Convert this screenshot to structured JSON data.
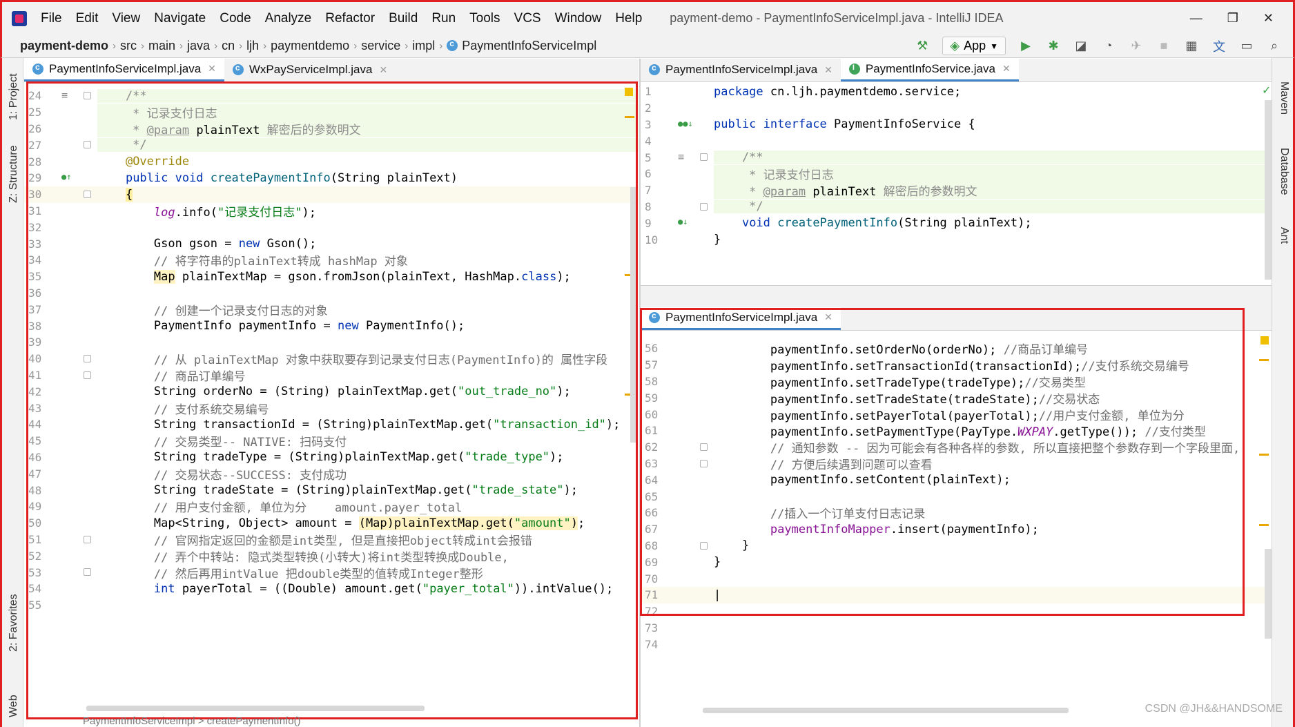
{
  "app": {
    "menu": [
      "File",
      "Edit",
      "View",
      "Navigate",
      "Code",
      "Analyze",
      "Refactor",
      "Build",
      "Run",
      "Tools",
      "VCS",
      "Window",
      "Help"
    ],
    "window_title": "payment-demo - PaymentInfoServiceImpl.java - IntelliJ IDEA",
    "controls": {
      "minimize": "—",
      "restore": "❐",
      "close": "✕"
    }
  },
  "breadcrumb": [
    "payment-demo",
    "src",
    "main",
    "java",
    "cn",
    "ljh",
    "paymentdemo",
    "service",
    "impl",
    "PaymentInfoServiceImpl"
  ],
  "toolbar": {
    "run_config": "App"
  },
  "left_strip": {
    "project": "1: Project",
    "structure": "Z: Structure",
    "favorites": "2: Favorites",
    "web": "Web"
  },
  "right_strip": {
    "maven": "Maven",
    "database": "Database",
    "ant": "Ant"
  },
  "left_pane": {
    "tabs": [
      {
        "label": "PaymentInfoServiceImpl.java",
        "active": true
      },
      {
        "label": "WxPayServiceImpl.java",
        "active": false
      }
    ],
    "lines": [
      {
        "n": "24",
        "c": [
          [
            "    /**",
            "doc"
          ]
        ],
        "doc": true
      },
      {
        "n": "25",
        "c": [
          [
            "     * 记录支付日志",
            "doc"
          ]
        ],
        "doc": true
      },
      {
        "n": "26",
        "c": [
          [
            "     * ",
            "doc"
          ],
          [
            "@param",
            "docu"
          ],
          [
            " plainText ",
            "doc-b"
          ],
          [
            "解密后的参数明文",
            "doc"
          ]
        ],
        "doc": true
      },
      {
        "n": "27",
        "c": [
          [
            "     */",
            "doc"
          ]
        ],
        "doc": true
      },
      {
        "n": "28",
        "c": [
          [
            "    ",
            ""
          ],
          [
            "@Override",
            "ann"
          ]
        ]
      },
      {
        "n": "29",
        "c": [
          [
            "    ",
            ""
          ],
          [
            "public void ",
            "kw"
          ],
          [
            "createPaymentInfo",
            "fn"
          ],
          [
            "(String plainText)",
            ""
          ]
        ]
      },
      {
        "n": "30",
        "c": [
          [
            "    ",
            ""
          ],
          [
            "{",
            "brace"
          ]
        ],
        "caret": true
      },
      {
        "n": "31",
        "c": [
          [
            "        ",
            ""
          ],
          [
            "log",
            "itl"
          ],
          [
            ".info(",
            ""
          ],
          [
            "\"记录支付日志\"",
            "str"
          ],
          [
            ");",
            ""
          ]
        ]
      },
      {
        "n": "32",
        "c": []
      },
      {
        "n": "33",
        "c": [
          [
            "        Gson gson = ",
            ""
          ],
          [
            "new ",
            "kw"
          ],
          [
            "Gson();",
            ""
          ]
        ]
      },
      {
        "n": "34",
        "c": [
          [
            "        ",
            ""
          ],
          [
            "// 将字符串的plainText转成 hashMap 对象",
            "cmg"
          ]
        ]
      },
      {
        "n": "35",
        "c": [
          [
            "        ",
            ""
          ],
          [
            "Map",
            "hlbg"
          ],
          [
            " plainTextMap = gson.fromJson(plainText, HashMap.",
            ""
          ],
          [
            "class",
            "kw"
          ],
          [
            ");",
            ""
          ]
        ]
      },
      {
        "n": "36",
        "c": []
      },
      {
        "n": "37",
        "c": [
          [
            "        ",
            ""
          ],
          [
            "// 创建一个记录支付日志的对象",
            "cmg"
          ]
        ]
      },
      {
        "n": "38",
        "c": [
          [
            "        PaymentInfo paymentInfo = ",
            ""
          ],
          [
            "new ",
            "kw"
          ],
          [
            "PaymentInfo();",
            ""
          ]
        ]
      },
      {
        "n": "39",
        "c": []
      },
      {
        "n": "40",
        "c": [
          [
            "        ",
            ""
          ],
          [
            "// 从 plainTextMap 对象中获取要存到记录支付日志(PaymentInfo)的 属性字段",
            "cmg"
          ]
        ]
      },
      {
        "n": "41",
        "c": [
          [
            "        ",
            ""
          ],
          [
            "// 商品订单编号",
            "cmg"
          ]
        ]
      },
      {
        "n": "42",
        "c": [
          [
            "        String orderNo = (String) plainTextMap.get(",
            ""
          ],
          [
            "\"out_trade_no\"",
            "str"
          ],
          [
            ");",
            ""
          ]
        ]
      },
      {
        "n": "43",
        "c": [
          [
            "        ",
            ""
          ],
          [
            "// 支付系统交易编号",
            "cmg"
          ]
        ]
      },
      {
        "n": "44",
        "c": [
          [
            "        String transactionId = (String)plainTextMap.get(",
            ""
          ],
          [
            "\"transaction_id\"",
            "str"
          ],
          [
            ");",
            ""
          ]
        ]
      },
      {
        "n": "45",
        "c": [
          [
            "        ",
            ""
          ],
          [
            "// 交易类型-- NATIVE: 扫码支付",
            "cmg"
          ]
        ]
      },
      {
        "n": "46",
        "c": [
          [
            "        String tradeType = (String)plainTextMap.get(",
            ""
          ],
          [
            "\"trade_type\"",
            "str"
          ],
          [
            ");",
            ""
          ]
        ]
      },
      {
        "n": "47",
        "c": [
          [
            "        ",
            ""
          ],
          [
            "// 交易状态--SUCCESS: 支付成功",
            "cmg"
          ]
        ]
      },
      {
        "n": "48",
        "c": [
          [
            "        String tradeState = (String)plainTextMap.get(",
            ""
          ],
          [
            "\"trade_state\"",
            "str"
          ],
          [
            ");",
            ""
          ]
        ]
      },
      {
        "n": "49",
        "c": [
          [
            "        ",
            ""
          ],
          [
            "// 用户支付金额, 单位为分    amount.payer_total",
            "cmg"
          ]
        ]
      },
      {
        "n": "50",
        "c": [
          [
            "        Map<String, Object> amount = ",
            ""
          ],
          [
            "(Map)plainTextMap.get(",
            "hlbg"
          ],
          [
            "\"amount\"",
            "str-hl"
          ],
          [
            ")",
            "hlbg"
          ],
          [
            ";",
            ""
          ]
        ]
      },
      {
        "n": "51",
        "c": [
          [
            "        ",
            ""
          ],
          [
            "// 官网指定返回的金额是int类型, 但是直接把object转成int会报错",
            "cmg"
          ]
        ]
      },
      {
        "n": "52",
        "c": [
          [
            "        ",
            ""
          ],
          [
            "// 弄个中转站: 隐式类型转换(小转大)将int类型转换成Double,",
            "cmg"
          ]
        ]
      },
      {
        "n": "53",
        "c": [
          [
            "        ",
            ""
          ],
          [
            "// 然后再用intValue 把double类型的值转成Integer整形",
            "cmg"
          ]
        ]
      },
      {
        "n": "54",
        "c": [
          [
            "        ",
            ""
          ],
          [
            "int ",
            "kw"
          ],
          [
            "payerTotal = ((Double) amount.get(",
            ""
          ],
          [
            "\"payer_total\"",
            "str"
          ],
          [
            ")).intValue();",
            ""
          ]
        ]
      },
      {
        "n": "55",
        "c": []
      }
    ]
  },
  "right_top_pane": {
    "tabs": [
      {
        "label": "PaymentInfoServiceImpl.java",
        "active": false
      },
      {
        "label": "PaymentInfoService.java",
        "active": true
      }
    ],
    "lines": [
      {
        "n": "1",
        "c": [
          [
            "package ",
            "kw"
          ],
          [
            "cn.ljh.paymentdemo.service;",
            ""
          ]
        ]
      },
      {
        "n": "2",
        "c": []
      },
      {
        "n": "3",
        "c": [
          [
            "public interface ",
            "kw"
          ],
          [
            "PaymentInfoService {",
            ""
          ]
        ]
      },
      {
        "n": "4",
        "c": []
      },
      {
        "n": "5",
        "c": [
          [
            "    /**",
            "doc"
          ]
        ],
        "doc": true
      },
      {
        "n": "6",
        "c": [
          [
            "     * 记录支付日志",
            "doc"
          ]
        ],
        "doc": true
      },
      {
        "n": "7",
        "c": [
          [
            "     * ",
            "doc"
          ],
          [
            "@param",
            "docu"
          ],
          [
            " plainText ",
            "doc-b"
          ],
          [
            "解密后的参数明文",
            "doc"
          ]
        ],
        "doc": true
      },
      {
        "n": "8",
        "c": [
          [
            "     */",
            "doc"
          ]
        ],
        "doc": true
      },
      {
        "n": "9",
        "c": [
          [
            "    ",
            ""
          ],
          [
            "void ",
            "kw"
          ],
          [
            "createPaymentInfo",
            "fn"
          ],
          [
            "(String plainText);",
            ""
          ]
        ]
      },
      {
        "n": "10",
        "c": [
          [
            "}",
            ""
          ]
        ]
      }
    ]
  },
  "right_bottom_pane": {
    "tabs": [
      {
        "label": "PaymentInfoServiceImpl.java",
        "active": true
      }
    ],
    "lines": [
      {
        "n": "56",
        "c": [
          [
            "        paymentInfo.setOrderNo(orderNo); ",
            ""
          ],
          [
            "//商品订单编号",
            "cmg"
          ]
        ]
      },
      {
        "n": "57",
        "c": [
          [
            "        paymentInfo.setTransactionId(transactionId);",
            ""
          ],
          [
            "//支付系统交易编号",
            "cmg"
          ]
        ]
      },
      {
        "n": "58",
        "c": [
          [
            "        paymentInfo.setTradeType(tradeType);",
            ""
          ],
          [
            "//交易类型",
            "cmg"
          ]
        ]
      },
      {
        "n": "59",
        "c": [
          [
            "        paymentInfo.setTradeState(tradeState);",
            ""
          ],
          [
            "//交易状态",
            "cmg"
          ]
        ]
      },
      {
        "n": "60",
        "c": [
          [
            "        paymentInfo.setPayerTotal(payerTotal);",
            ""
          ],
          [
            "//用户支付金额, 单位为分",
            "cmg"
          ]
        ]
      },
      {
        "n": "61",
        "c": [
          [
            "        paymentInfo.setPaymentType(PayType.",
            ""
          ],
          [
            "WXPAY",
            "itl"
          ],
          [
            ".getType()); ",
            ""
          ],
          [
            "//支付类型",
            "cmg"
          ]
        ]
      },
      {
        "n": "62",
        "c": [
          [
            "        ",
            ""
          ],
          [
            "// 通知参数 -- 因为可能会有各种各样的参数, 所以直接把整个参数存到一个字段里面,",
            "cmg"
          ]
        ]
      },
      {
        "n": "63",
        "c": [
          [
            "        ",
            ""
          ],
          [
            "// 方便后续遇到问题可以查看",
            "cmg"
          ]
        ]
      },
      {
        "n": "64",
        "c": [
          [
            "        paymentInfo.setContent(plainText);",
            ""
          ]
        ]
      },
      {
        "n": "65",
        "c": []
      },
      {
        "n": "66",
        "c": [
          [
            "        ",
            ""
          ],
          [
            "//插入一个订单支付日志记录",
            "cmg"
          ]
        ]
      },
      {
        "n": "67",
        "c": [
          [
            "        ",
            ""
          ],
          [
            "paymentInfoMapper",
            "fld"
          ],
          [
            ".insert(paymentInfo);",
            ""
          ]
        ]
      },
      {
        "n": "68",
        "c": [
          [
            "    }",
            ""
          ]
        ]
      },
      {
        "n": "69",
        "c": [
          [
            "}",
            ""
          ]
        ]
      },
      {
        "n": "70",
        "c": []
      },
      {
        "n": "71",
        "c": [
          [
            "|",
            "caret"
          ]
        ],
        "caret": true
      },
      {
        "n": "72",
        "c": []
      },
      {
        "n": "73",
        "c": []
      },
      {
        "n": "74",
        "c": []
      }
    ]
  },
  "status_breadcrumb": "PaymentInfoServiceImpl  >  createPaymentInfo()",
  "watermark": "CSDN @JH&&HANDSOME"
}
